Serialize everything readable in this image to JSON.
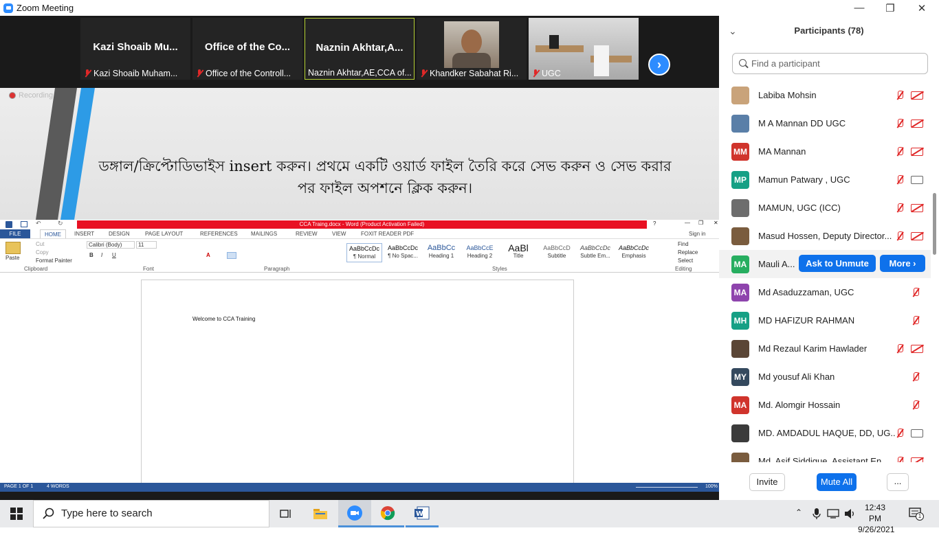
{
  "window": {
    "title": "Zoom Meeting",
    "minimize": "—",
    "maximize": "❐",
    "close": "✕"
  },
  "gallery": {
    "tiles": [
      {
        "name": "Kazi  Shoaib  Mu...",
        "label": "Kazi Shoaib Muham...",
        "muted": true
      },
      {
        "name": "Office  of  the  Co...",
        "label": "Office of the Controll...",
        "muted": true
      },
      {
        "name": "Naznin  Akhtar,A...",
        "label": "Naznin Akhtar,AE,CCA of...",
        "muted": false
      },
      {
        "name": "",
        "label": "Khandker Sabahat Ri...",
        "muted": true
      },
      {
        "name": "",
        "label": "UGC",
        "muted": true
      }
    ],
    "next_label": "›"
  },
  "share": {
    "recording_label": "Recording",
    "slide_text": "ডঙ্গাল/ক্রিপ্টোডিভাইস insert করুন। প্রথমে একটি ওয়ার্ড ফাইল তৈরি করে সেভ করুন ও সেভ করার পর ফাইল অপশনে ক্লিক করুন।",
    "word": {
      "title": "CCA Traing.docx - Word (Product Activation Failed)",
      "help": "?",
      "sign_in": "Sign in",
      "tabs": [
        "FILE",
        "HOME",
        "INSERT",
        "DESIGN",
        "PAGE LAYOUT",
        "REFERENCES",
        "MAILINGS",
        "REVIEW",
        "VIEW",
        "FOXIT READER PDF"
      ],
      "clipboard": {
        "paste": "Paste",
        "cut": "Cut",
        "copy": "Copy",
        "format_painter": "Format Painter",
        "group": "Clipboard"
      },
      "font": {
        "name": "Calibri (Body)",
        "size": "11",
        "group": "Font"
      },
      "paragraph_group": "Paragraph",
      "styles": [
        {
          "preview": "AaBbCcDc",
          "name": "¶ Normal"
        },
        {
          "preview": "AaBbCcDc",
          "name": "¶ No Spac..."
        },
        {
          "preview": "AaBbCc",
          "name": "Heading 1"
        },
        {
          "preview": "AaBbCcE",
          "name": "Heading 2"
        },
        {
          "preview": "AaBl",
          "name": "Title"
        },
        {
          "preview": "AaBbCcD",
          "name": "Subtitle"
        },
        {
          "preview": "AaBbCcDc",
          "name": "Subtle Em..."
        },
        {
          "preview": "AaBbCcDc",
          "name": "Emphasis"
        }
      ],
      "styles_group": "Styles",
      "editing": {
        "find": "Find",
        "replace": "Replace",
        "select": "Select",
        "group": "Editing"
      },
      "document_text": "Welcome to CCA Training",
      "status": {
        "page": "PAGE 1 OF 1",
        "words": "4 WORDS",
        "zoom": "100%"
      }
    }
  },
  "participants": {
    "title": "Participants (78)",
    "search_placeholder": "Find a participant",
    "list": [
      {
        "name": "Labiba Mohsin",
        "initials": "",
        "color": "#c9a37a",
        "cam": "off"
      },
      {
        "name": "M A Mannan DD UGC",
        "initials": "",
        "color": "#5a7fa8",
        "cam": "off"
      },
      {
        "name": "MA Mannan",
        "initials": "MM",
        "color": "#d0342c",
        "cam": "off"
      },
      {
        "name": "Mamun Patwary , UGC",
        "initials": "MP",
        "color": "#16a085",
        "cam": "on"
      },
      {
        "name": "MAMUN, UGC (ICC)",
        "initials": "",
        "color": "#6d6d6d",
        "cam": "off"
      },
      {
        "name": "Masud Hossen, Deputy Director...",
        "initials": "",
        "color": "#7a5c3e",
        "cam": "off"
      },
      {
        "name": "Mauli A...",
        "initials": "MA",
        "color": "#27ae60",
        "cam": "none"
      },
      {
        "name": "Md Asaduzzaman, UGC",
        "initials": "MA",
        "color": "#8e44ad",
        "cam": "none"
      },
      {
        "name": "MD HAFIZUR RAHMAN",
        "initials": "MH",
        "color": "#16a085",
        "cam": "none"
      },
      {
        "name": "Md Rezaul Karim Hawlader",
        "initials": "",
        "color": "#5b4636",
        "cam": "off"
      },
      {
        "name": "Md yousuf Ali Khan",
        "initials": "MY",
        "color": "#34495e",
        "cam": "none"
      },
      {
        "name": "Md. Alomgir Hossain",
        "initials": "MA",
        "color": "#d0342c",
        "cam": "none"
      },
      {
        "name": "MD. AMDADUL HAQUE, DD, UG...",
        "initials": "",
        "color": "#3b3b3b",
        "cam": "on"
      },
      {
        "name": "Md. Asif Siddique, Assistant En...",
        "initials": "",
        "color": "#7a5c3e",
        "cam": "off"
      }
    ],
    "ask_to_unmute": "Ask to Unmute",
    "more": "More ›",
    "invite": "Invite",
    "mute_all": "Mute All",
    "overflow": "..."
  },
  "taskbar": {
    "search_placeholder": "Type here to search",
    "time": "12:43 PM",
    "date": "9/26/2021",
    "notifications": "1"
  }
}
